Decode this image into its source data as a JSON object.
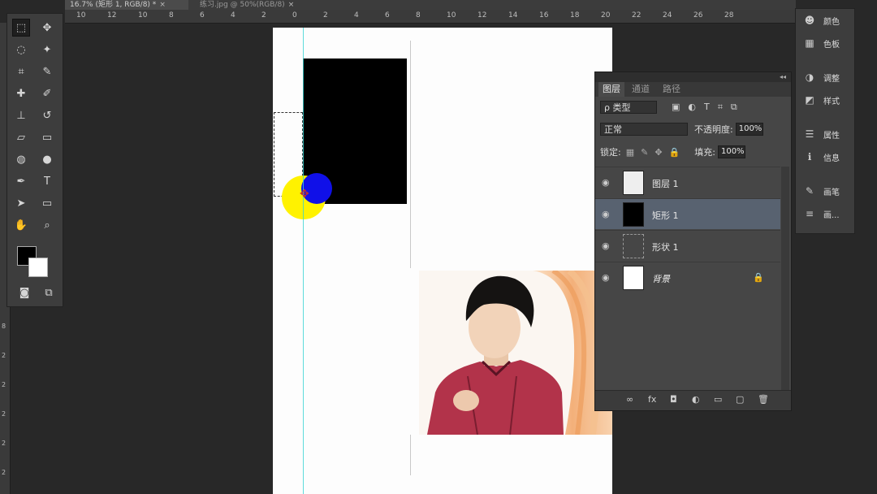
{
  "tabs": [
    {
      "label": "16.7% (矩形 1, RGB/8) *",
      "close": "×"
    },
    {
      "label": "练习.jpg @ 50%(RGB/8)",
      "close": "×"
    }
  ],
  "ruler_top": [
    "10",
    "12",
    "10",
    "8",
    "6",
    "4",
    "2",
    "0",
    "2",
    "4",
    "6",
    "8",
    "10",
    "12",
    "14",
    "16",
    "18",
    "20",
    "22",
    "24",
    "26",
    "28"
  ],
  "ruler_left": [
    "8",
    "2",
    "2",
    "2",
    "2",
    "2"
  ],
  "toolbar": {
    "tools": [
      {
        "name": "rect-marquee",
        "glyph": "⬚"
      },
      {
        "name": "move",
        "glyph": "✥"
      },
      {
        "name": "lasso",
        "glyph": "◌"
      },
      {
        "name": "magic-wand",
        "glyph": "✦"
      },
      {
        "name": "crop",
        "glyph": "⌗"
      },
      {
        "name": "eyedropper",
        "glyph": "✎"
      },
      {
        "name": "spot-heal",
        "glyph": "✚"
      },
      {
        "name": "brush",
        "glyph": "✐"
      },
      {
        "name": "stamp",
        "glyph": "⊥"
      },
      {
        "name": "history-brush",
        "glyph": "↺"
      },
      {
        "name": "eraser",
        "glyph": "▱"
      },
      {
        "name": "gradient",
        "glyph": "▭"
      },
      {
        "name": "blur",
        "glyph": "◍"
      },
      {
        "name": "dodge",
        "glyph": "●"
      },
      {
        "name": "pen",
        "glyph": "✒"
      },
      {
        "name": "type",
        "glyph": "T"
      },
      {
        "name": "path-select",
        "glyph": "➤"
      },
      {
        "name": "shape",
        "glyph": "▭"
      },
      {
        "name": "hand",
        "glyph": "✋"
      },
      {
        "name": "zoom",
        "glyph": "⌕"
      }
    ]
  },
  "layers_panel": {
    "collapse": "◂◂",
    "tabs": [
      "图层",
      "通道",
      "路径"
    ],
    "filter_label": "ρ 类型",
    "blend_mode": "正常",
    "opacity_label": "不透明度:",
    "opacity_value": "100%",
    "lock_label": "锁定:",
    "fill_label": "填充:",
    "fill_value": "100%",
    "layers": [
      {
        "name": "图层 1",
        "selected": false,
        "locked": false
      },
      {
        "name": "矩形 1",
        "selected": true,
        "locked": false
      },
      {
        "name": "形状 1",
        "selected": false,
        "locked": false
      },
      {
        "name": "背景",
        "selected": false,
        "locked": true
      }
    ],
    "bottom_icons": [
      "∞",
      "fx",
      "◘",
      "◐",
      "▭",
      "▢",
      "🗑"
    ]
  },
  "dock": {
    "items": [
      {
        "icon": "palette-icon",
        "glyph": "☻",
        "label": "颜色"
      },
      {
        "icon": "swatches-icon",
        "glyph": "▦",
        "label": "色板"
      },
      {
        "icon": "adjustments-icon",
        "glyph": "◑",
        "label": "调整"
      },
      {
        "icon": "styles-icon",
        "glyph": "◩",
        "label": "样式"
      },
      {
        "icon": "properties-icon",
        "glyph": "☰",
        "label": "属性"
      },
      {
        "icon": "info-icon",
        "glyph": "ℹ",
        "label": "信息"
      },
      {
        "icon": "brush-icon",
        "glyph": "✎",
        "label": "画笔"
      },
      {
        "icon": "brush-preset-icon",
        "glyph": "≡",
        "label": "画..."
      }
    ]
  },
  "colors": {
    "accent_selected": "#586270",
    "guide": "#37d2d2",
    "yellow": "#fff200",
    "blue": "#1010e8"
  }
}
